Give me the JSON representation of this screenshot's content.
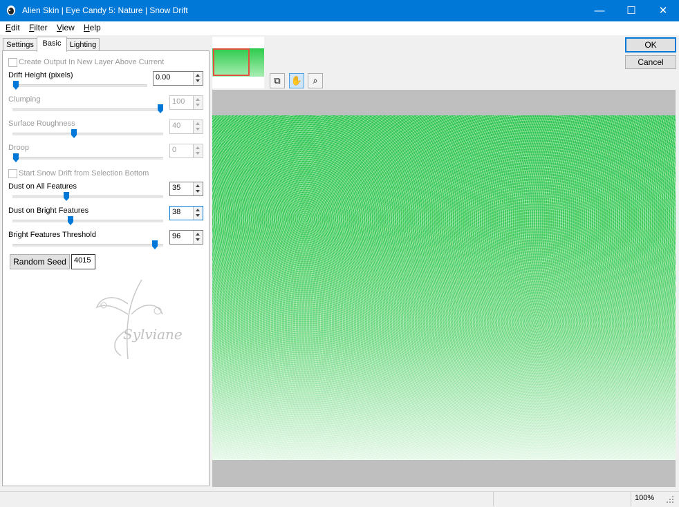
{
  "window": {
    "title": "Alien Skin | Eye Candy 5: Nature | Snow Drift",
    "minimize": "—",
    "maximize": "☐",
    "close": "✕"
  },
  "menu": [
    {
      "label": "Edit",
      "accel": "E",
      "rest": "dit"
    },
    {
      "label": "Filter",
      "accel": "F",
      "rest": "ilter"
    },
    {
      "label": "View",
      "accel": "V",
      "rest": "iew"
    },
    {
      "label": "Help",
      "accel": "H",
      "rest": "elp"
    }
  ],
  "tabs": [
    "Settings",
    "Basic",
    "Lighting"
  ],
  "basic": {
    "create_output": "Create Output In New Layer Above Current",
    "drift_height": {
      "label": "Drift Height (pixels)",
      "value": "0.00"
    },
    "clumping": {
      "label": "Clumping",
      "value": "100"
    },
    "surface_roughness": {
      "label": "Surface Roughness",
      "value": "40"
    },
    "droop": {
      "label": "Droop",
      "value": "0"
    },
    "start_snow": "Start Snow Drift from Selection Bottom",
    "dust_all": {
      "label": "Dust on All Features",
      "value": "35"
    },
    "dust_bright": {
      "label": "Dust on Bright Features",
      "value": "38"
    },
    "bright_threshold": {
      "label": "Bright Features Threshold",
      "value": "96"
    },
    "random_seed_button": "Random Seed",
    "random_seed_value": "4015",
    "watermark": "Sylviane"
  },
  "buttons": {
    "ok": "OK",
    "cancel": "Cancel"
  },
  "status": {
    "zoom": "100%"
  }
}
